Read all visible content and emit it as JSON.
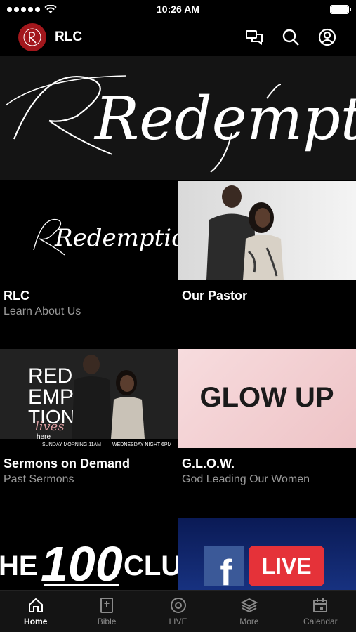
{
  "status": {
    "time": "10:26 AM"
  },
  "header": {
    "app_title": "RLC"
  },
  "banner": {
    "script_text": "Redemption"
  },
  "tiles": [
    {
      "title": "RLC",
      "subtitle": "Learn About Us",
      "thumb_text": "Redemption"
    },
    {
      "title": "Our Pastor",
      "subtitle": ""
    },
    {
      "title": "Sermons on Demand",
      "subtitle": "Past Sermons",
      "poster": {
        "line1": "RED",
        "line2": "EMP",
        "line3": "TION",
        "script": "lives",
        "small": "here",
        "left_time": "SUNDAY MORNING 11AM",
        "right_time": "WEDNESDAY NIGHT 6PM"
      }
    },
    {
      "title": "G.L.O.W.",
      "subtitle": "God Leading Our Women",
      "thumb_text": "GLOW UP"
    },
    {
      "thumb_text_a": "HE",
      "thumb_text_b": "100",
      "thumb_text_c": "CLU"
    },
    {
      "thumb_text": "LIVE",
      "fb_letter": "f"
    }
  ],
  "tabs": [
    {
      "label": "Home",
      "icon": "home-icon",
      "active": true
    },
    {
      "label": "Bible",
      "icon": "bible-icon"
    },
    {
      "label": "LIVE",
      "icon": "live-icon"
    },
    {
      "label": "More",
      "icon": "more-icon"
    },
    {
      "label": "Calendar",
      "icon": "calendar-icon"
    }
  ],
  "colors": {
    "accent": "#a2171c",
    "background": "#000000",
    "tabbar": "#141414",
    "muted": "#9a9a9a",
    "glow_bg": "#f2cfd1",
    "fb_blue": "#3b5998",
    "live_red": "#e53239"
  }
}
